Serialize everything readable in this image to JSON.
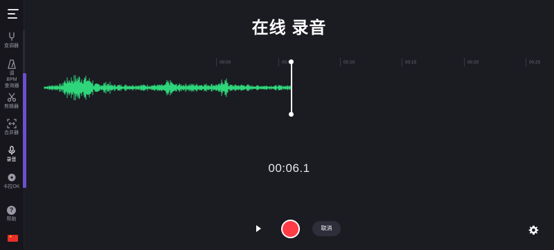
{
  "app": {
    "title": "在线 录音"
  },
  "sidebar": {
    "menu_icon": "hamburger-icon",
    "items": [
      {
        "label": "变调器",
        "icon": "tuning-fork-icon",
        "active": false
      },
      {
        "label": "调 BPM 查询器",
        "icon": "metronome-icon",
        "active": false
      },
      {
        "label": "剪辑器",
        "icon": "scissors-icon",
        "active": false
      },
      {
        "label": "合并器",
        "icon": "merge-icon",
        "active": false
      },
      {
        "label": "录音",
        "icon": "microphone-icon",
        "active": true
      },
      {
        "label": "卡拉OK",
        "icon": "disc-icon",
        "active": false
      }
    ],
    "help": {
      "label": "帮助",
      "icon": "question-icon",
      "glyph": "?"
    },
    "flag": {
      "icon": "china-flag-icon",
      "glyph": "★"
    }
  },
  "timeline": {
    "ticks": [
      "00:00",
      "00:05",
      "00:10",
      "00:15",
      "00:20",
      "00:25"
    ]
  },
  "recorder": {
    "elapsed": "00:06.1",
    "wave_color": "#2fd57a"
  },
  "controls": {
    "play_icon": "play-icon",
    "record_icon": "record-icon",
    "cancel_label": "取消",
    "settings_icon": "gear-icon"
  },
  "colors": {
    "background": "#1b1b22",
    "sidebar": "#16161c",
    "accent": "#6a50d0",
    "record": "#ff3b45",
    "wave": "#2fd57a"
  }
}
